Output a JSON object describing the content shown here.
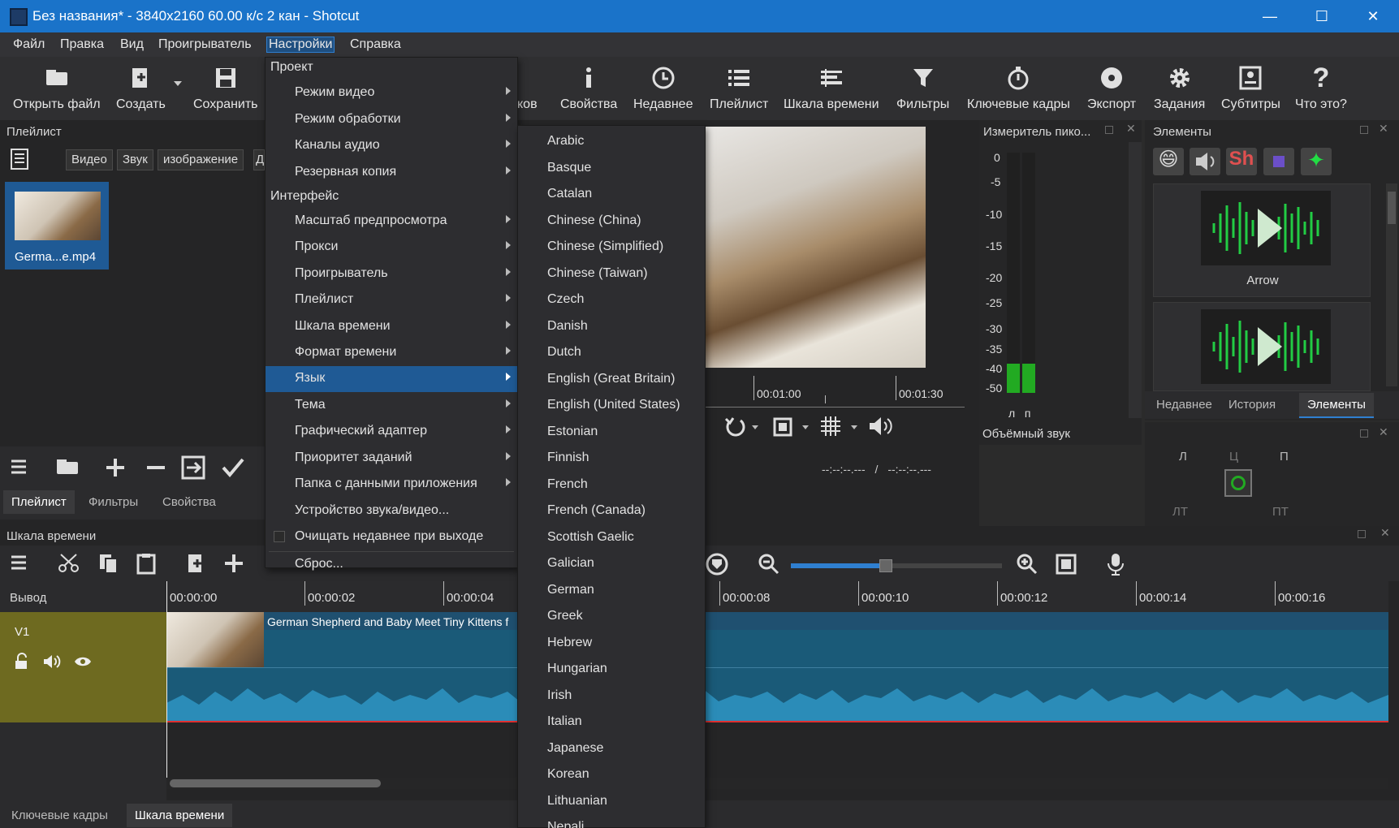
{
  "window": {
    "title": "Без названия* - 3840x2160 60.00 к/с 2 кан - Shotcut",
    "minimize": "—",
    "maximize": "☐",
    "close": "✕"
  },
  "menubar": [
    "Файл",
    "Правка",
    "Вид",
    "Проигрыватель",
    "Настройки",
    "Справка"
  ],
  "toolbar": {
    "open": "Открыть файл",
    "create": "Создать",
    "save": "Сохранить",
    "hidden": "ков",
    "properties": "Свойства",
    "recent": "Недавнее",
    "playlist": "Плейлист",
    "timeline": "Шкала времени",
    "filters": "Фильтры",
    "keyframes": "Ключевые кадры",
    "export": "Экспорт",
    "jobs": "Задания",
    "subtitles": "Субтитры",
    "whatsthis": "Что это?"
  },
  "playlist": {
    "title": "Плейлист",
    "chips": [
      "Видео",
      "Звук",
      "изображение",
      "Д"
    ],
    "clip_name": "Germa...e.mp4",
    "tabs": [
      "Плейлист",
      "Фильтры",
      "Свойства"
    ]
  },
  "settings_menu": {
    "section_project": "Проект",
    "project_items": [
      "Режим видео",
      "Режим обработки",
      "Каналы аудио",
      "Резервная копия"
    ],
    "section_interface": "Интерфейс",
    "interface_items": [
      "Масштаб предпросмотра",
      "Прокси",
      "Проигрыватель",
      "Плейлист",
      "Шкала времени",
      "Формат времени",
      "Язык",
      "Тема",
      "Графический адаптер",
      "Приоритет заданий",
      "Папка с данными приложения"
    ],
    "device": "Устройство звука/видео...",
    "clear_recent": "Очищать недавнее при выходе",
    "reset": "Сброс..."
  },
  "languages": [
    "Arabic",
    "Basque",
    "Catalan",
    "Chinese (China)",
    "Chinese (Simplified)",
    "Chinese (Taiwan)",
    "Czech",
    "Danish",
    "Dutch",
    "English (Great Britain)",
    "English (United States)",
    "Estonian",
    "Finnish",
    "French",
    "French (Canada)",
    "Scottish Gaelic",
    "Galician",
    "German",
    "Greek",
    "Hebrew",
    "Hungarian",
    "Irish",
    "Italian",
    "Japanese",
    "Korean",
    "Lithuanian",
    "Nepali"
  ],
  "player": {
    "ruler": [
      "00:01:00",
      "00:01:30"
    ],
    "time_in": "--:--:--.---",
    "separator": "/",
    "time_out": "--:--:--.---"
  },
  "meter": {
    "title": "Измеритель пико...",
    "scale": [
      "0",
      "-5",
      "-10",
      "-15",
      "-20",
      "-25",
      "-30",
      "-35",
      "-40",
      "-50"
    ],
    "channels": "л   п",
    "surround": "Объёмный звук",
    "level_left": 0.12,
    "level_right": 0.12
  },
  "elements": {
    "title": "Элементы",
    "icons": [
      "Sh"
    ],
    "item1": "Arrow",
    "tabs": [
      "Недавнее",
      "История",
      "Элементы"
    ]
  },
  "audio_pan": {
    "labels": [
      "Л",
      "Ц",
      "П",
      "ЛТ",
      "ПТ"
    ]
  },
  "timeline": {
    "title": "Шкала времени",
    "output": "Вывод",
    "track": "V1",
    "clip_title": "German Shepherd and Baby Meet Tiny Kittens f",
    "ruler": [
      "00:00:00",
      "00:00:02",
      "00:00:04",
      "00:00:08",
      "00:00:10",
      "00:00:12",
      "00:00:14",
      "00:00:16"
    ],
    "zoom_level": 0.45
  },
  "bottom_tabs": [
    "Ключевые кадры",
    "Шкала времени"
  ],
  "colors": {
    "titlebar": "#1a73c9",
    "highlight": "#1f5a95",
    "track": "#6e6a20",
    "clip": "#1a5a78",
    "waveform": "#2b8cb8",
    "meter": "#22aa22",
    "playhead": "#e03030"
  }
}
